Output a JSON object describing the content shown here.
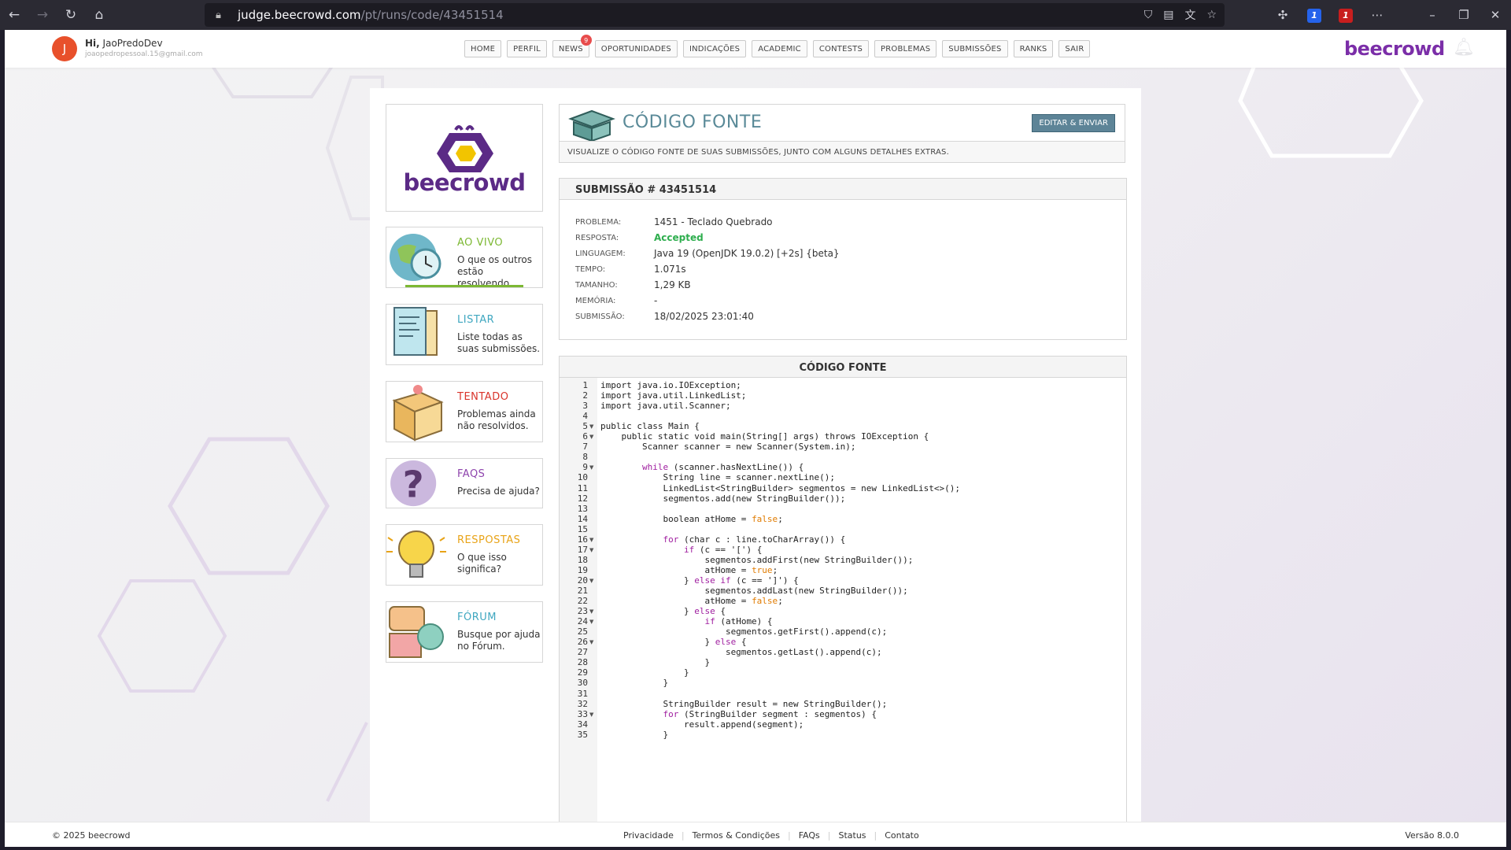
{
  "browser": {
    "url_host": "judge.beecrowd.com",
    "url_path": "/pt/runs/code/43451514",
    "ext_blue_badge": "1",
    "ext_red_badge": "1"
  },
  "header": {
    "avatar_initial": "J",
    "greeting": "Hi,",
    "username": "JaoPredoDev",
    "email": "joaopedropessoal.15@gmail.com",
    "brand": "beecrowd",
    "nav": [
      {
        "label": "HOME"
      },
      {
        "label": "PERFIL"
      },
      {
        "label": "NEWS",
        "badge": "9"
      },
      {
        "label": "OPORTUNIDADES"
      },
      {
        "label": "INDICAÇÕES"
      },
      {
        "label": "ACADEMIC"
      },
      {
        "label": "CONTESTS"
      },
      {
        "label": "PROBLEMAS"
      },
      {
        "label": "SUBMISSÕES"
      },
      {
        "label": "RANKS"
      },
      {
        "label": "SAIR"
      }
    ]
  },
  "sidebar": {
    "logo_text": "beecrowd",
    "cards": [
      {
        "title": "AO VIVO",
        "desc": "O que os outros estão resolvendo.",
        "color": "#7cb833"
      },
      {
        "title": "LISTAR",
        "desc": "Liste todas as suas submissões.",
        "color": "#3fa7c0"
      },
      {
        "title": "TENTADO",
        "desc": "Problemas ainda não resolvidos.",
        "color": "#d9342b"
      },
      {
        "title": "FAQS",
        "desc": "Precisa de ajuda?",
        "color": "#8e44ad"
      },
      {
        "title": "RESPOSTAS",
        "desc": "O que isso significa?",
        "color": "#e8a317"
      },
      {
        "title": "FÓRUM",
        "desc": "Busque por ajuda no Fórum.",
        "color": "#3fa7c0"
      }
    ]
  },
  "source_header": {
    "title": "CÓDIGO FONTE",
    "edit_button": "EDITAR & ENVIAR",
    "subtitle": "VISUALIZE O CÓDIGO FONTE DE SUAS SUBMISSÕES, JUNTO COM ALGUNS DETALHES EXTRAS."
  },
  "submission": {
    "heading": "SUBMISSÃO # 43451514",
    "fields": [
      {
        "label": "PROBLEMA:",
        "value": "1451 - Teclado Quebrado"
      },
      {
        "label": "RESPOSTA:",
        "value": "Accepted"
      },
      {
        "label": "LINGUAGEM:",
        "value": "Java 19 (OpenJDK 19.0.2) [+2s] {beta}"
      },
      {
        "label": "TEMPO:",
        "value": "1.071s"
      },
      {
        "label": "TAMANHO:",
        "value": "1,29 KB"
      },
      {
        "label": "MEMÓRIA:",
        "value": "-"
      },
      {
        "label": "SUBMISSÃO:",
        "value": "18/02/2025 23:01:40"
      }
    ]
  },
  "code": {
    "heading": "CÓDIGO FONTE",
    "lines": [
      "import java.io.IOException;",
      "import java.util.LinkedList;",
      "import java.util.Scanner;",
      "",
      "public class Main {",
      "    public static void main(String[] args) throws IOException {",
      "        Scanner scanner = new Scanner(System.in);",
      "",
      "        while (scanner.hasNextLine()) {",
      "            String line = scanner.nextLine();",
      "            LinkedList<StringBuilder> segmentos = new LinkedList<>();",
      "            segmentos.add(new StringBuilder());",
      "",
      "            boolean atHome = false;",
      "",
      "            for (char c : line.toCharArray()) {",
      "                if (c == '[') {",
      "                    segmentos.addFirst(new StringBuilder());",
      "                    atHome = true;",
      "                } else if (c == ']') {",
      "                    segmentos.addLast(new StringBuilder());",
      "                    atHome = false;",
      "                } else {",
      "                    if (atHome) {",
      "                        segmentos.getFirst().append(c);",
      "                    } else {",
      "                        segmentos.getLast().append(c);",
      "                    }",
      "                }",
      "            }",
      "",
      "            StringBuilder result = new StringBuilder();",
      "            for (StringBuilder segment : segmentos) {",
      "                result.append(segment);",
      "            }"
    ],
    "fold_lines": [
      5,
      6,
      9,
      16,
      17,
      20,
      23,
      24,
      26,
      33
    ]
  },
  "footer": {
    "copyright": "© 2025 beecrowd",
    "links": [
      "Privacidade",
      "Termos & Condições",
      "FAQs",
      "Status",
      "Contato"
    ],
    "version": "Versão 8.0.0"
  }
}
